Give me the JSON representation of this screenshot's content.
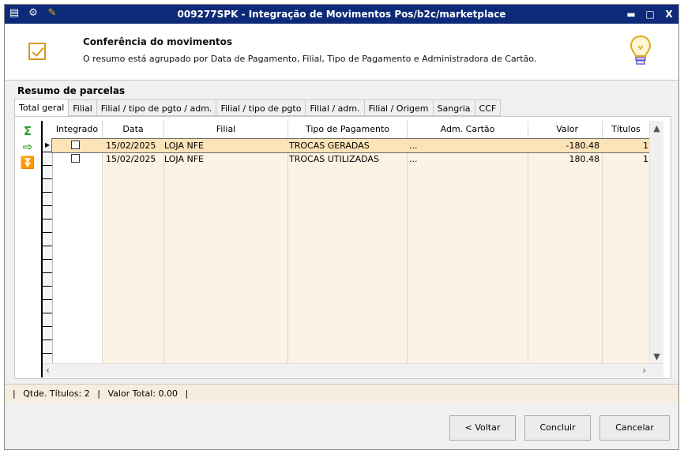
{
  "window": {
    "title": "009277SPK - Integração de Movimentos Pos/b2c/marketplace",
    "controls": [
      "minimize-icon",
      "maximize-icon",
      "close-icon"
    ],
    "control_glyphs": [
      "▬",
      "□",
      "X"
    ],
    "left_icons": [
      "menu-icon",
      "settings-icon",
      "wrench-icon"
    ],
    "left_glyphs": [
      "▤",
      "⚙",
      "✎"
    ]
  },
  "header": {
    "title": "Conferência do movimentos",
    "description": "O resumo está agrupado por Data de Pagamento, Filial, Tipo de Pagamento e Administradora de Cartão."
  },
  "section_label": "Resumo de parcelas",
  "tabs": [
    {
      "label": "Total geral",
      "active": true
    },
    {
      "label": "Filial",
      "active": false
    },
    {
      "label": "Filial / tipo de pgto / adm.",
      "active": false
    },
    {
      "label": "Filial / tipo de pgto",
      "active": false
    },
    {
      "label": "Filial / adm.",
      "active": false
    },
    {
      "label": "Filial / Origem",
      "active": false
    },
    {
      "label": "Sangria",
      "active": false
    },
    {
      "label": "CCF",
      "active": false
    }
  ],
  "side_tools": [
    {
      "name": "sum-icon",
      "glyph": "Σ"
    },
    {
      "name": "export-icon",
      "glyph": "⇨"
    },
    {
      "name": "expand-icon",
      "glyph": "⏬"
    }
  ],
  "grid": {
    "columns": [
      "Integrado",
      "Data",
      "Filial",
      "Tipo de Pagamento",
      "Adm. Cartão",
      "Valor",
      "Títulos"
    ],
    "rows": [
      {
        "integrado": false,
        "data": "15/02/2025",
        "filial": "LOJA NFE",
        "tipo": "TROCAS GERADAS",
        "adm": "...",
        "valor": "-180.48",
        "titulos": "1",
        "selected": true
      },
      {
        "integrado": false,
        "data": "15/02/2025",
        "filial": "LOJA NFE",
        "tipo": "TROCAS UTILIZADAS",
        "adm": "...",
        "valor": "180.48",
        "titulos": "1",
        "selected": false
      }
    ]
  },
  "status": {
    "sep": "|",
    "titulos": "Qtde. Títulos: 2",
    "total": "Valor Total: 0.00"
  },
  "buttons": {
    "back": "< Voltar",
    "finish": "Concluir",
    "cancel": "Cancelar"
  },
  "colors": {
    "titlebar": "#0c2a78",
    "accent": "#d69a1e",
    "row_selected": "#fbe3b7",
    "row_tan": "#fdf3e4",
    "tool_green": "#2e9e2e"
  }
}
